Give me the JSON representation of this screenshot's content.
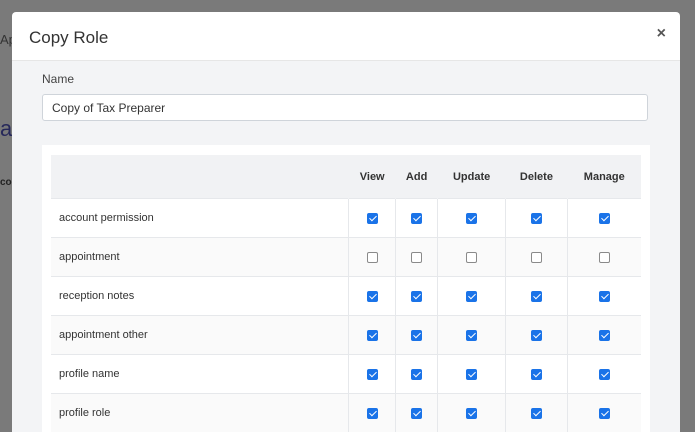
{
  "background": {
    "fragment_1": "Ap",
    "fragment_2": "ag",
    "fragment_3": "col"
  },
  "modal": {
    "title": "Copy Role",
    "close_glyph": "×",
    "name_label": "Name",
    "name_value": "Copy of Tax Preparer"
  },
  "table": {
    "columns": [
      "View",
      "Add",
      "Update",
      "Delete",
      "Manage"
    ],
    "rows": [
      {
        "name": "account permission",
        "checks": [
          true,
          true,
          true,
          true,
          true
        ]
      },
      {
        "name": "appointment",
        "checks": [
          false,
          false,
          false,
          false,
          false
        ]
      },
      {
        "name": "reception notes",
        "checks": [
          true,
          true,
          true,
          true,
          true
        ]
      },
      {
        "name": "appointment other",
        "checks": [
          true,
          true,
          true,
          true,
          true
        ]
      },
      {
        "name": "profile name",
        "checks": [
          true,
          true,
          true,
          true,
          true
        ]
      },
      {
        "name": "profile role",
        "checks": [
          true,
          true,
          true,
          true,
          true
        ]
      }
    ]
  },
  "colors": {
    "checkbox_checked": "#1a73e8",
    "overlay": "#7a7a7a"
  }
}
